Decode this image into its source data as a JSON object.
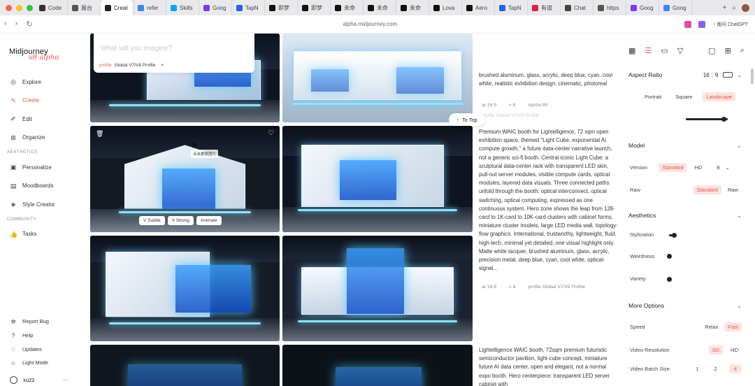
{
  "browser": {
    "tabs": [
      {
        "label": "Code",
        "icon": "github-icon",
        "color": "#333333"
      },
      {
        "label": "展台",
        "icon": "globe-icon",
        "color": "#555555"
      },
      {
        "label": "Creat",
        "icon": "midjourney-icon",
        "color": "#222222",
        "active": true
      },
      {
        "label": "refer",
        "icon": "refer-icon",
        "color": "#3b82f6"
      },
      {
        "label": "Skills",
        "icon": "skills-icon",
        "color": "#0ea5e9"
      },
      {
        "label": "Goog",
        "icon": "gemini-icon",
        "color": "#7c3aed"
      },
      {
        "label": "TapN",
        "icon": "tapnow-icon",
        "color": "#2563eb"
      },
      {
        "label": "即梦",
        "icon": "jimeng-icon",
        "color": "#111111"
      },
      {
        "label": "即梦",
        "icon": "jimeng-icon",
        "color": "#111111"
      },
      {
        "label": "未命",
        "icon": "tiktok-icon",
        "color": "#111111"
      },
      {
        "label": "未命",
        "icon": "tiktok-icon",
        "color": "#111111"
      },
      {
        "label": "未命",
        "icon": "tiktok-icon",
        "color": "#111111"
      },
      {
        "label": "Lova",
        "icon": "lovart-icon",
        "color": "#111111"
      },
      {
        "label": "Aero",
        "icon": "openai-icon",
        "color": "#111111"
      },
      {
        "label": "TapN",
        "icon": "tapnow-icon",
        "color": "#2563eb"
      },
      {
        "label": "有道",
        "icon": "youdao-icon",
        "color": "#e11d48"
      },
      {
        "label": "Chat",
        "icon": "chatgpt-icon",
        "color": "#444444"
      },
      {
        "label": "https",
        "icon": "google-icon",
        "color": "#555555"
      },
      {
        "label": "Goog",
        "icon": "gemini-icon",
        "color": "#7c3aed"
      },
      {
        "label": "Goog",
        "icon": "google-icon",
        "color": "#4285f4"
      }
    ],
    "url": "alpha.midjourney.com",
    "ask_chatgpt": "询问 ChatGPT"
  },
  "sidebar": {
    "logo": "Midjourney",
    "logo_sub": "v8 alpha",
    "items": [
      {
        "label": "Explore",
        "icon": "compass-icon"
      },
      {
        "label": "Create",
        "icon": "brush-icon",
        "active": true
      },
      {
        "label": "Edit",
        "icon": "edit-icon"
      },
      {
        "label": "Organize",
        "icon": "grid-icon"
      }
    ],
    "aesthetics_label": "AESTHETICS",
    "aesthetics_items": [
      {
        "label": "Personalize",
        "icon": "personalize-icon"
      },
      {
        "label": "Moodboards",
        "icon": "moodboard-icon"
      },
      {
        "label": "Style Creator",
        "icon": "palette-icon"
      }
    ],
    "community_label": "COMMUNITY",
    "community_items": [
      {
        "label": "Tasks",
        "icon": "thumbs-up-icon"
      }
    ],
    "bottom_items": [
      {
        "label": "Report Bug",
        "icon": "bug-icon"
      },
      {
        "label": "Help",
        "icon": "help-icon"
      },
      {
        "label": "Updates",
        "icon": "bell-icon"
      },
      {
        "label": "Light Mode",
        "icon": "sun-icon"
      }
    ],
    "user": "xuzz",
    "user_more": "···"
  },
  "main": {
    "prompt_placeholder": "What will you imagine?",
    "profile_key": "profile",
    "profile_value": "Global V7/V8 Profile",
    "profile_close": "×",
    "to_top": "To Top",
    "tooltip": "点击更换图片",
    "image_actions": [
      "V Subtle",
      "V Strong",
      "Animate"
    ],
    "prompt1_tail": "brushed aluminum, glass, acrylic, deep blue, cyan, cool white, realistic exhibition design, cinematic, photoreal",
    "prompt1_meta": [
      "ar 16:9",
      "v 8",
      "stylize 80"
    ],
    "prompt1_profile_faded": "profile Global V7/V8 Profile",
    "prompt2": "Premium WAIC booth for Lightelligence, 72 sqm open exhibition space, themed \"Light Cube, exponential AI compute growth,\" a future data-center narrative launch, not a generic sci-fi booth. Central iconic Light Cube: a sculptural data-center rack with transparent LED skin, pull-out server modules, visible compute cards, optical modules, layered data visuals. Three connected paths unfold through the booth: optical interconnect, optical switching, optical computing, expressed as one continuous system. Hero zone shows the leap from 128-card to 1K-card to 10K-card clusters with cabinet forms, miniature cluster models, large LED media wall, topology-flow graphics. International, trustworthy, lightweight, fluid, high-tech, minimal yet detailed, one visual highlight only. Matte white lacquer, brushed aluminum, glass, acrylic, precision metal, deep blue, cyan, cool white, optical-signal...",
    "prompt2_meta": [
      "ar 16:9",
      "v 8",
      "profile Global V7/V8 Profile"
    ],
    "prompt3": "Lightelligence WAIC booth, 72sqm premium futuristic semiconductor pavilion, light-cube concept, miniature future AI data center, open and elegant, not a normal expo booth. Hero centerpiece: transparent LED server cabinet with"
  },
  "settings": {
    "toolbar_icons": [
      "image-icon",
      "sliders-icon",
      "folder-icon",
      "filter-icon",
      "chat-icon",
      "layout-icon",
      "search-icon"
    ],
    "aspect_ratio_label": "Aspect Ratio",
    "ar_w": "16",
    "ar_sep": ":",
    "ar_h": "9",
    "orientation": [
      "Portrait",
      "Square",
      "Landscape"
    ],
    "orientation_selected": "Landscape",
    "size_slider_value": 0.9,
    "model_label": "Model",
    "version_label": "Version",
    "version_options": [
      "Standard",
      "HD"
    ],
    "version_selected": "Standard",
    "version_number": "8",
    "raw_label": "Raw",
    "raw_options": [
      "Standard",
      "Raw"
    ],
    "raw_selected": "Standard",
    "aesthetics_label": "Aesthetics",
    "stylization_label": "Stylization",
    "stylization_value": 0.1,
    "weirdness_label": "Weirdness",
    "weirdness_value": 0,
    "variety_label": "Variety",
    "variety_value": 0,
    "more_options_label": "More Options",
    "speed_label": "Speed",
    "speed_options": [
      "Relax",
      "Fast"
    ],
    "speed_selected": "Fast",
    "video_res_label": "Video Resolution",
    "video_res_options": [
      "SD",
      "HD"
    ],
    "video_res_selected": "SD",
    "video_batch_label": "Video Batch Size",
    "video_batch_options": [
      "1",
      "2",
      "4"
    ],
    "video_batch_selected": "4"
  },
  "colors": {
    "accent": "#e0584d",
    "accent_bg": "#fde3df",
    "glow": "#6fd8ff"
  }
}
